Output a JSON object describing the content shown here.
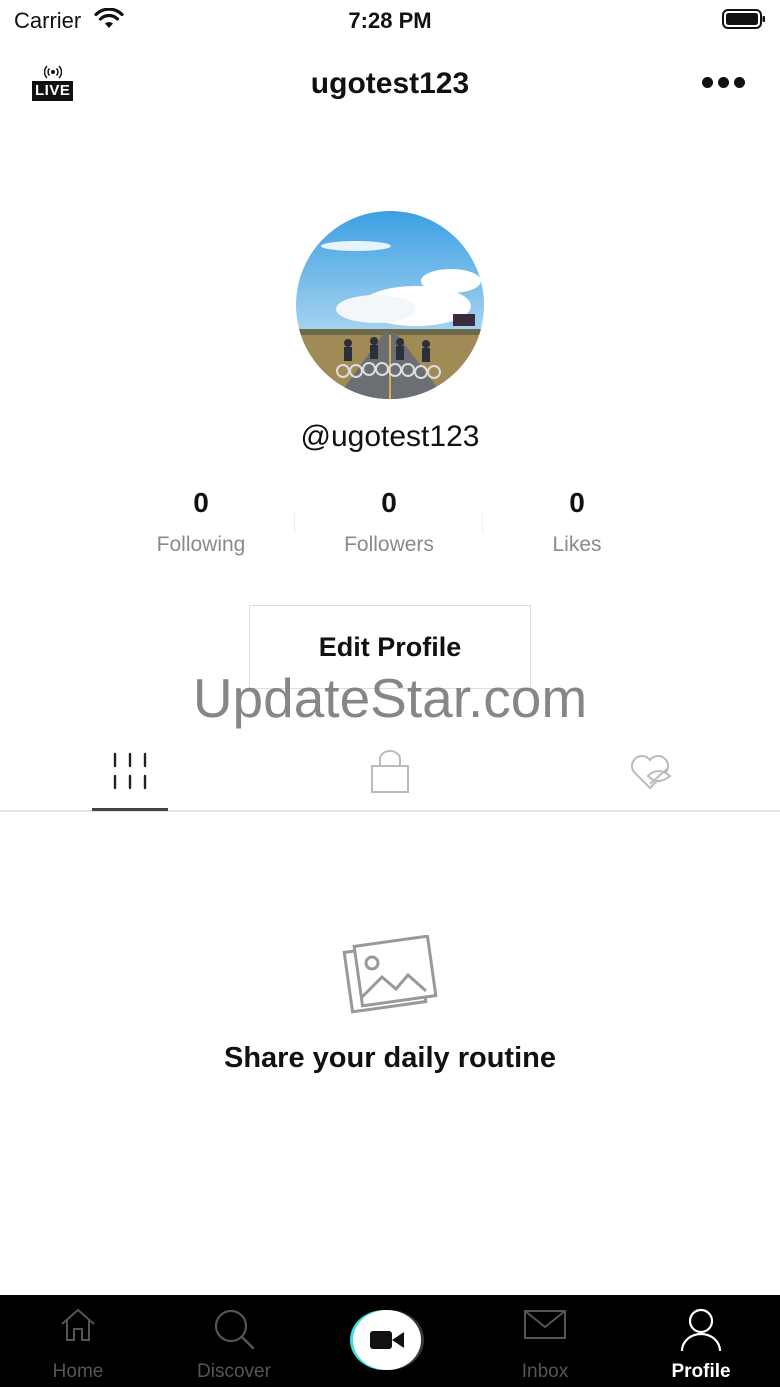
{
  "status_bar": {
    "carrier": "Carrier",
    "time": "7:28 PM"
  },
  "header": {
    "title": "ugotest123",
    "live_label": "LIVE"
  },
  "profile": {
    "handle": "@ugotest123"
  },
  "stats": [
    {
      "value": "0",
      "label": "Following"
    },
    {
      "value": "0",
      "label": "Followers"
    },
    {
      "value": "0",
      "label": "Likes"
    }
  ],
  "edit_profile_label": "Edit Profile",
  "watermark": "UpdateStar.com",
  "tabs": {
    "icons": [
      "grid-icon",
      "lock-icon",
      "hidden-heart-icon"
    ]
  },
  "empty_state": {
    "icon": "image-icon",
    "text": "Share your daily routine"
  },
  "tabbar": {
    "items": [
      {
        "label": "Home",
        "icon": "home-icon"
      },
      {
        "label": "Discover",
        "icon": "search-icon"
      },
      {
        "label": "",
        "icon": "video-camera-icon"
      },
      {
        "label": "Inbox",
        "icon": "mail-icon"
      },
      {
        "label": "Profile",
        "icon": "person-icon"
      }
    ]
  },
  "colors": {
    "accent_cyan": "#35e0e6",
    "tabbar_bg": "#000000",
    "muted": "#8a8a8a"
  }
}
